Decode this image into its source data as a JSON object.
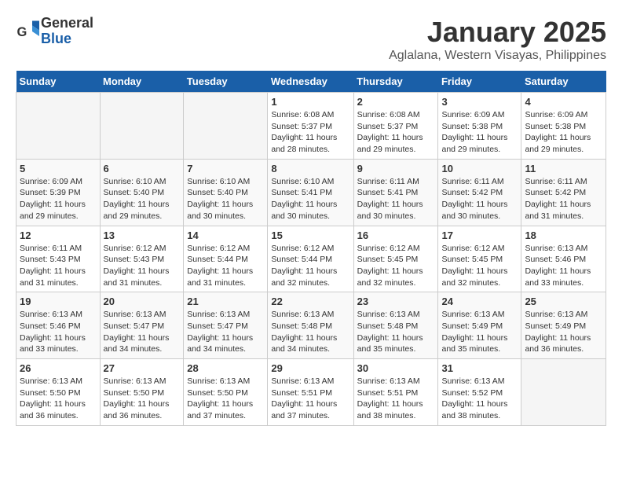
{
  "logo": {
    "general": "General",
    "blue": "Blue"
  },
  "header": {
    "title": "January 2025",
    "subtitle": "Aglalana, Western Visayas, Philippines"
  },
  "days_of_week": [
    "Sunday",
    "Monday",
    "Tuesday",
    "Wednesday",
    "Thursday",
    "Friday",
    "Saturday"
  ],
  "weeks": [
    [
      {
        "day": "",
        "info": ""
      },
      {
        "day": "",
        "info": ""
      },
      {
        "day": "",
        "info": ""
      },
      {
        "day": "1",
        "info": "Sunrise: 6:08 AM\nSunset: 5:37 PM\nDaylight: 11 hours and 28 minutes."
      },
      {
        "day": "2",
        "info": "Sunrise: 6:08 AM\nSunset: 5:37 PM\nDaylight: 11 hours and 29 minutes."
      },
      {
        "day": "3",
        "info": "Sunrise: 6:09 AM\nSunset: 5:38 PM\nDaylight: 11 hours and 29 minutes."
      },
      {
        "day": "4",
        "info": "Sunrise: 6:09 AM\nSunset: 5:38 PM\nDaylight: 11 hours and 29 minutes."
      }
    ],
    [
      {
        "day": "5",
        "info": "Sunrise: 6:09 AM\nSunset: 5:39 PM\nDaylight: 11 hours and 29 minutes."
      },
      {
        "day": "6",
        "info": "Sunrise: 6:10 AM\nSunset: 5:40 PM\nDaylight: 11 hours and 29 minutes."
      },
      {
        "day": "7",
        "info": "Sunrise: 6:10 AM\nSunset: 5:40 PM\nDaylight: 11 hours and 30 minutes."
      },
      {
        "day": "8",
        "info": "Sunrise: 6:10 AM\nSunset: 5:41 PM\nDaylight: 11 hours and 30 minutes."
      },
      {
        "day": "9",
        "info": "Sunrise: 6:11 AM\nSunset: 5:41 PM\nDaylight: 11 hours and 30 minutes."
      },
      {
        "day": "10",
        "info": "Sunrise: 6:11 AM\nSunset: 5:42 PM\nDaylight: 11 hours and 30 minutes."
      },
      {
        "day": "11",
        "info": "Sunrise: 6:11 AM\nSunset: 5:42 PM\nDaylight: 11 hours and 31 minutes."
      }
    ],
    [
      {
        "day": "12",
        "info": "Sunrise: 6:11 AM\nSunset: 5:43 PM\nDaylight: 11 hours and 31 minutes."
      },
      {
        "day": "13",
        "info": "Sunrise: 6:12 AM\nSunset: 5:43 PM\nDaylight: 11 hours and 31 minutes."
      },
      {
        "day": "14",
        "info": "Sunrise: 6:12 AM\nSunset: 5:44 PM\nDaylight: 11 hours and 31 minutes."
      },
      {
        "day": "15",
        "info": "Sunrise: 6:12 AM\nSunset: 5:44 PM\nDaylight: 11 hours and 32 minutes."
      },
      {
        "day": "16",
        "info": "Sunrise: 6:12 AM\nSunset: 5:45 PM\nDaylight: 11 hours and 32 minutes."
      },
      {
        "day": "17",
        "info": "Sunrise: 6:12 AM\nSunset: 5:45 PM\nDaylight: 11 hours and 32 minutes."
      },
      {
        "day": "18",
        "info": "Sunrise: 6:13 AM\nSunset: 5:46 PM\nDaylight: 11 hours and 33 minutes."
      }
    ],
    [
      {
        "day": "19",
        "info": "Sunrise: 6:13 AM\nSunset: 5:46 PM\nDaylight: 11 hours and 33 minutes."
      },
      {
        "day": "20",
        "info": "Sunrise: 6:13 AM\nSunset: 5:47 PM\nDaylight: 11 hours and 34 minutes."
      },
      {
        "day": "21",
        "info": "Sunrise: 6:13 AM\nSunset: 5:47 PM\nDaylight: 11 hours and 34 minutes."
      },
      {
        "day": "22",
        "info": "Sunrise: 6:13 AM\nSunset: 5:48 PM\nDaylight: 11 hours and 34 minutes."
      },
      {
        "day": "23",
        "info": "Sunrise: 6:13 AM\nSunset: 5:48 PM\nDaylight: 11 hours and 35 minutes."
      },
      {
        "day": "24",
        "info": "Sunrise: 6:13 AM\nSunset: 5:49 PM\nDaylight: 11 hours and 35 minutes."
      },
      {
        "day": "25",
        "info": "Sunrise: 6:13 AM\nSunset: 5:49 PM\nDaylight: 11 hours and 36 minutes."
      }
    ],
    [
      {
        "day": "26",
        "info": "Sunrise: 6:13 AM\nSunset: 5:50 PM\nDaylight: 11 hours and 36 minutes."
      },
      {
        "day": "27",
        "info": "Sunrise: 6:13 AM\nSunset: 5:50 PM\nDaylight: 11 hours and 36 minutes."
      },
      {
        "day": "28",
        "info": "Sunrise: 6:13 AM\nSunset: 5:50 PM\nDaylight: 11 hours and 37 minutes."
      },
      {
        "day": "29",
        "info": "Sunrise: 6:13 AM\nSunset: 5:51 PM\nDaylight: 11 hours and 37 minutes."
      },
      {
        "day": "30",
        "info": "Sunrise: 6:13 AM\nSunset: 5:51 PM\nDaylight: 11 hours and 38 minutes."
      },
      {
        "day": "31",
        "info": "Sunrise: 6:13 AM\nSunset: 5:52 PM\nDaylight: 11 hours and 38 minutes."
      },
      {
        "day": "",
        "info": ""
      }
    ]
  ]
}
